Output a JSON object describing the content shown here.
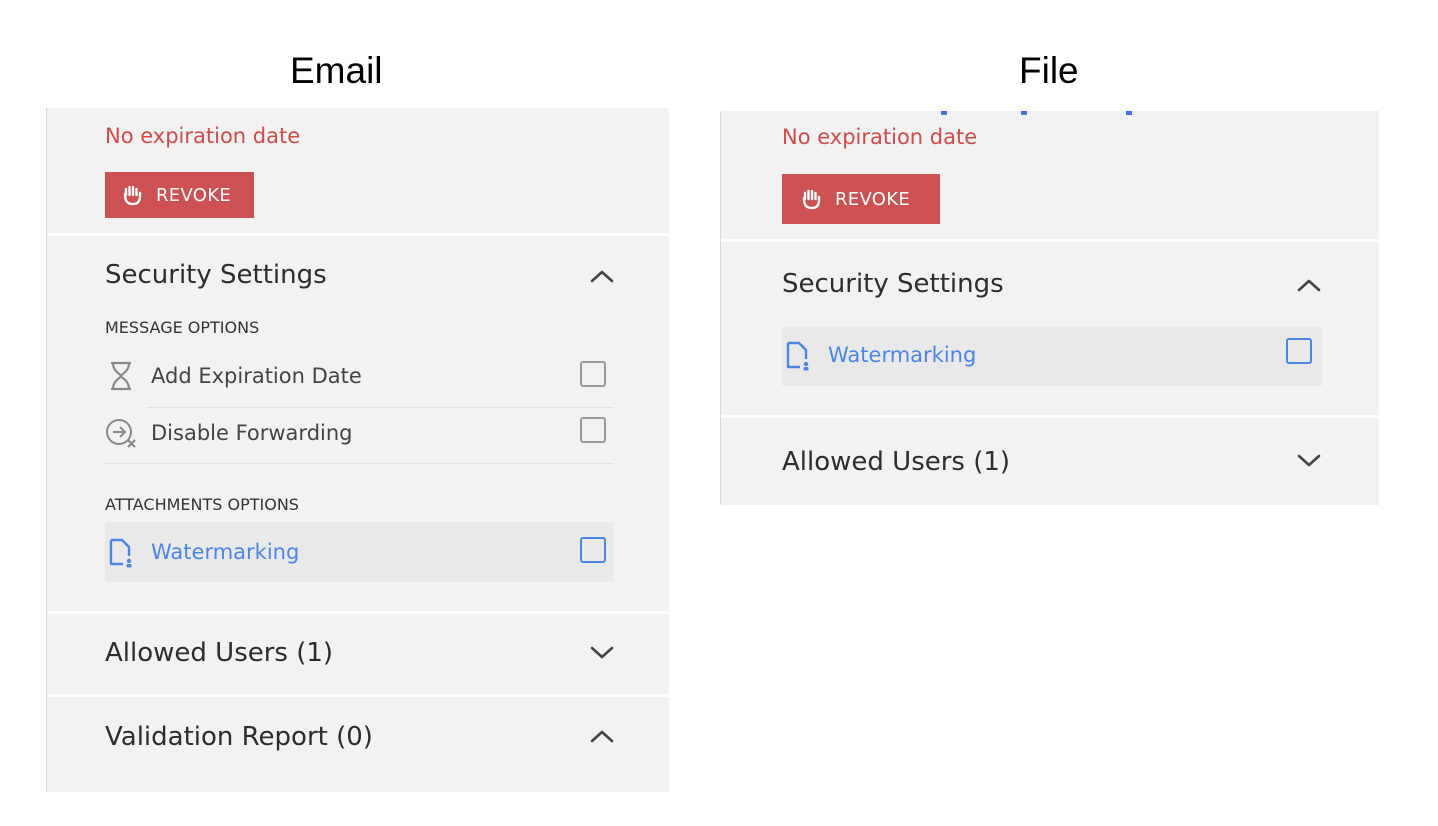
{
  "titles": {
    "email": "Email",
    "file": "File"
  },
  "email": {
    "expiration": "No expiration date",
    "revoke_label": "REVOKE",
    "security_settings": "Security Settings",
    "message_options_label": "MESSAGE OPTIONS",
    "add_expiration": "Add Expiration Date",
    "disable_forwarding": "Disable Forwarding",
    "attachments_options_label": "ATTACHMENTS OPTIONS",
    "watermarking": "Watermarking",
    "allowed_users": "Allowed Users (1)",
    "validation_report": "Validation Report (0)"
  },
  "file": {
    "expiration": "No expiration date",
    "revoke_label": "REVOKE",
    "security_settings": "Security Settings",
    "watermarking": "Watermarking",
    "allowed_users": "Allowed Users (1)"
  },
  "colors": {
    "accent_red": "#cd5151",
    "expiry_text": "#d24a4a",
    "link_blue": "#4a86e8",
    "panel_bg": "#f2f2f2"
  },
  "icons": [
    "hand-icon",
    "hourglass-icon",
    "forward-disabled-icon",
    "watermark-doc-icon",
    "chevron-up-icon",
    "chevron-down-icon"
  ]
}
